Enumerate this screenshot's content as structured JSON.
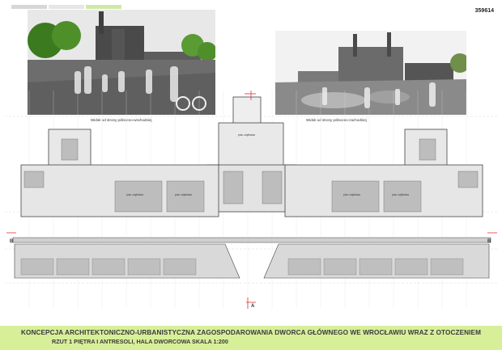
{
  "header": {
    "sheet_number": "359614",
    "swatches": [
      "#d7d7d7",
      "#e6e6e6",
      "#cfe9a8"
    ]
  },
  "renders": [
    {
      "caption": "Widok od strony północno-wschodniej"
    },
    {
      "caption": "Widok od strony północno-zachodniej"
    }
  ],
  "plan": {
    "section_marker": "B",
    "axis_marker": "A",
    "room_label_common": "pow. użytkowa"
  },
  "title": {
    "main": "KONCEPCJA  ARCHITEKTONICZNO-URBANISTYCZNA ZAGOSPODAROWANIA DWORCA GŁÓWNEGO  WE WROCŁAWIU WRAZ Z OTOCZENIEM",
    "sub": "RZUT 1 PIĘTRA I ANTRESOLI, HALA  DWORCOWA SKALA 1:200"
  }
}
